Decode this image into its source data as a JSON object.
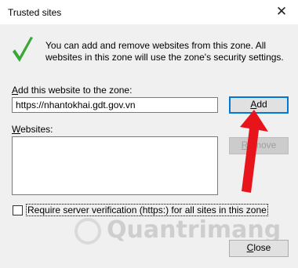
{
  "dialog": {
    "title": "Trusted sites",
    "close_glyph": "✕"
  },
  "info": {
    "text": "You can add and remove websites from this zone. All websites in this zone will use the zone's security settings.",
    "icon": "checkmark-icon",
    "icon_color": "#3aa839"
  },
  "add_section": {
    "label_prefix": "A",
    "label_rest": "dd this website to the zone:",
    "input_value": "https://nhantokhai.gdt.gov.vn",
    "add_button": "Add",
    "add_button_underline": "A",
    "add_button_rest": "dd"
  },
  "websites": {
    "label_prefix": "W",
    "label_rest": "ebsites:",
    "items": [],
    "remove_button_prefix": "R",
    "remove_button_rest": "emove"
  },
  "verification": {
    "checked": false,
    "label": "Require server verification (https:) for all sites in this zone"
  },
  "footer": {
    "close_button_prefix": "C",
    "close_button_rest": "lose"
  },
  "watermark": {
    "text": "Quantrimang"
  },
  "annotation": {
    "arrow_color": "#e8141c"
  }
}
